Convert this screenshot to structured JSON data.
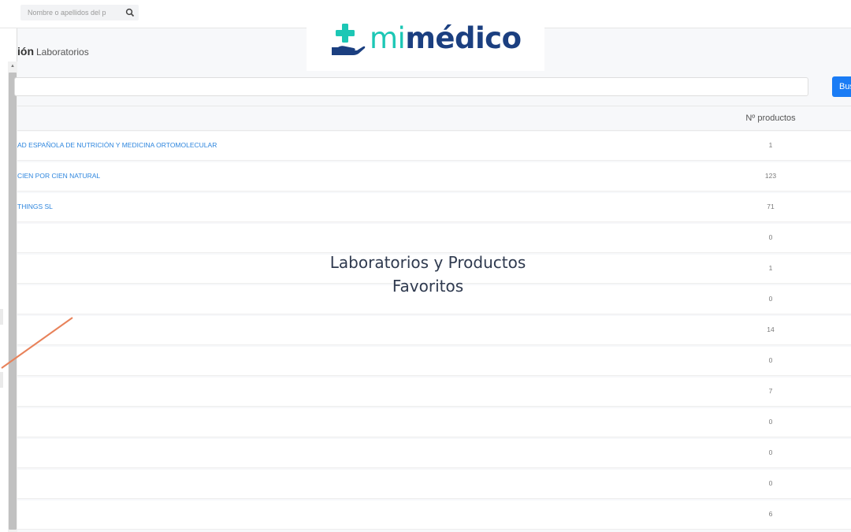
{
  "topbar": {
    "search_placeholder": "Nombre o apellidos del p",
    "search_icon": "search-icon"
  },
  "page": {
    "title_partial": "ión",
    "subtitle": "Laboratorios"
  },
  "filter": {
    "button_label": "Bus"
  },
  "table": {
    "count_header": "Nº productos",
    "rows": [
      {
        "name": "AD ESPAÑOLA DE NUTRICIÓN Y MEDICINA ORTOMOLECULAR",
        "count": "1"
      },
      {
        "name": "CIEN POR CIEN NATURAL",
        "count": "123"
      },
      {
        "name": "THINGS SL",
        "count": "71"
      },
      {
        "name": "",
        "count": "0"
      },
      {
        "name": "",
        "count": "1"
      },
      {
        "name": "",
        "count": "0"
      },
      {
        "name": "",
        "count": "14"
      },
      {
        "name": "",
        "count": "0"
      },
      {
        "name": "",
        "count": "7"
      },
      {
        "name": "",
        "count": "0"
      },
      {
        "name": "",
        "count": "0"
      },
      {
        "name": "",
        "count": "0"
      },
      {
        "name": "",
        "count": "6"
      }
    ]
  },
  "logo": {
    "brand_mi": "mi",
    "brand_medico": "médico"
  },
  "caption": {
    "line1": "Laboratorios y Productos",
    "line2": "Favoritos"
  },
  "colors": {
    "link": "#2e86de",
    "button": "#1a7cf5",
    "logo_teal": "#1cc7b5",
    "logo_navy": "#1b3f80",
    "arrow": "#e8825a"
  }
}
